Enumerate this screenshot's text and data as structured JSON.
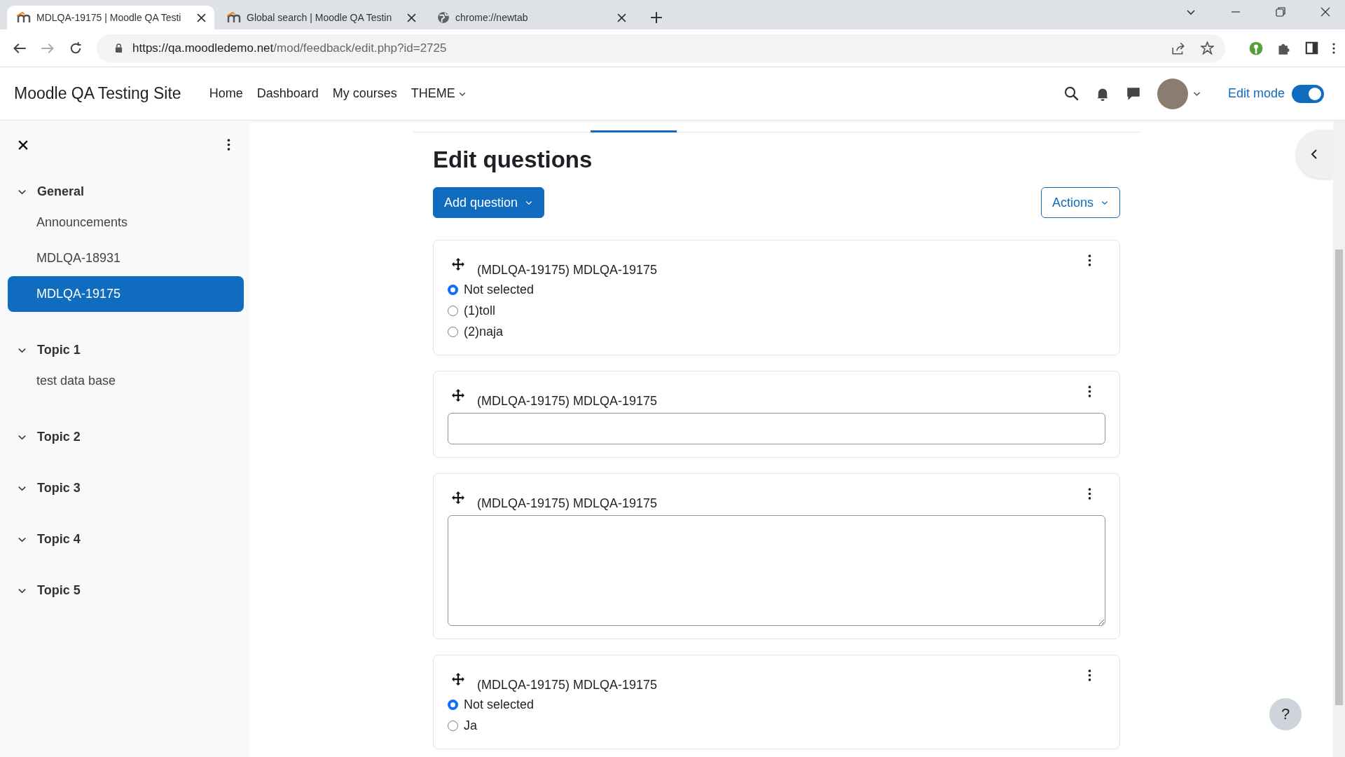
{
  "browser": {
    "tabs": [
      {
        "title": "MDLQA-19175 | Moodle QA Testi",
        "kind": "site",
        "selected": true
      },
      {
        "title": "Global search | Moodle QA Testin",
        "kind": "site",
        "selected": false
      },
      {
        "title": "chrome://newtab",
        "kind": "newtab",
        "selected": false
      }
    ],
    "address": {
      "host": "https://qa.moodledemo.net",
      "path": "/mod/feedback/edit.php?id=2725"
    }
  },
  "navbar": {
    "site_name": "Moodle QA Testing Site",
    "links": [
      {
        "label": "Home",
        "dropdown": false
      },
      {
        "label": "Dashboard",
        "dropdown": false
      },
      {
        "label": "My courses",
        "dropdown": false
      },
      {
        "label": "THEME",
        "dropdown": true
      }
    ],
    "edit_mode": {
      "label": "Edit mode",
      "on": true
    }
  },
  "sidebar": {
    "sections": [
      {
        "title": "General",
        "expanded": true,
        "items": [
          {
            "label": "Announcements",
            "selected": false
          },
          {
            "label": "MDLQA-18931",
            "selected": false
          },
          {
            "label": "MDLQA-19175",
            "selected": true
          }
        ]
      },
      {
        "title": "Topic 1",
        "expanded": true,
        "items": [
          {
            "label": "test data base",
            "selected": false
          }
        ]
      },
      {
        "title": "Topic 2",
        "expanded": true
      },
      {
        "title": "Topic 3",
        "expanded": true
      },
      {
        "title": "Topic 4",
        "expanded": true
      },
      {
        "title": "Topic 5",
        "expanded": true
      }
    ]
  },
  "main": {
    "heading": "Edit questions",
    "add_button": "Add question",
    "actions_button": "Actions",
    "questions": [
      {
        "title": "(MDLQA-19175) MDLQA-19175",
        "kind": "radio",
        "options": [
          {
            "label": "Not selected",
            "selected": true
          },
          {
            "label": "(1)toll",
            "selected": false
          },
          {
            "label": "(2)naja",
            "selected": false
          }
        ]
      },
      {
        "title": "(MDLQA-19175) MDLQA-19175",
        "kind": "text"
      },
      {
        "title": "(MDLQA-19175) MDLQA-19175",
        "kind": "textarea"
      },
      {
        "title": "(MDLQA-19175) MDLQA-19175",
        "kind": "radio",
        "options": [
          {
            "label": "Not selected",
            "selected": true
          },
          {
            "label": "Ja",
            "selected": false
          }
        ]
      }
    ]
  },
  "help_button": "?"
}
